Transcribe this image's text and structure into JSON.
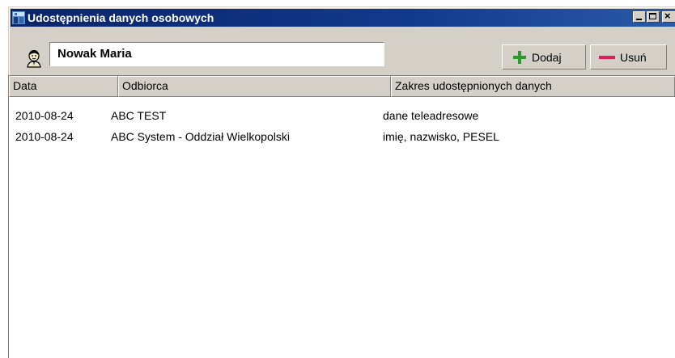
{
  "window": {
    "title": "Udostępnienia danych osobowych",
    "controls": {
      "minimize_icon": "minimize-icon",
      "maximize_icon": "maximize-icon",
      "close_icon": "close-icon"
    }
  },
  "toolbar": {
    "person_icon": "person-icon",
    "name_value": "Nowak Maria",
    "add_label": "Dodaj",
    "add_icon": "plus-icon",
    "remove_label": "Usuń",
    "remove_icon": "minus-icon"
  },
  "table": {
    "columns": [
      "Data",
      "Odbiorca",
      "Zakres udostępnionych danych"
    ],
    "rows": [
      [
        "2010-08-24",
        "ABC TEST",
        "dane teleadresowe"
      ],
      [
        "2010-08-24",
        "ABC System - Oddział Wielkopolski",
        "imię, nazwisko, PESEL"
      ]
    ]
  },
  "colors": {
    "titlebar": "#0a246a",
    "face": "#d4d0c8",
    "add_icon": "#2e9a2e",
    "remove_icon": "#e0205a"
  }
}
